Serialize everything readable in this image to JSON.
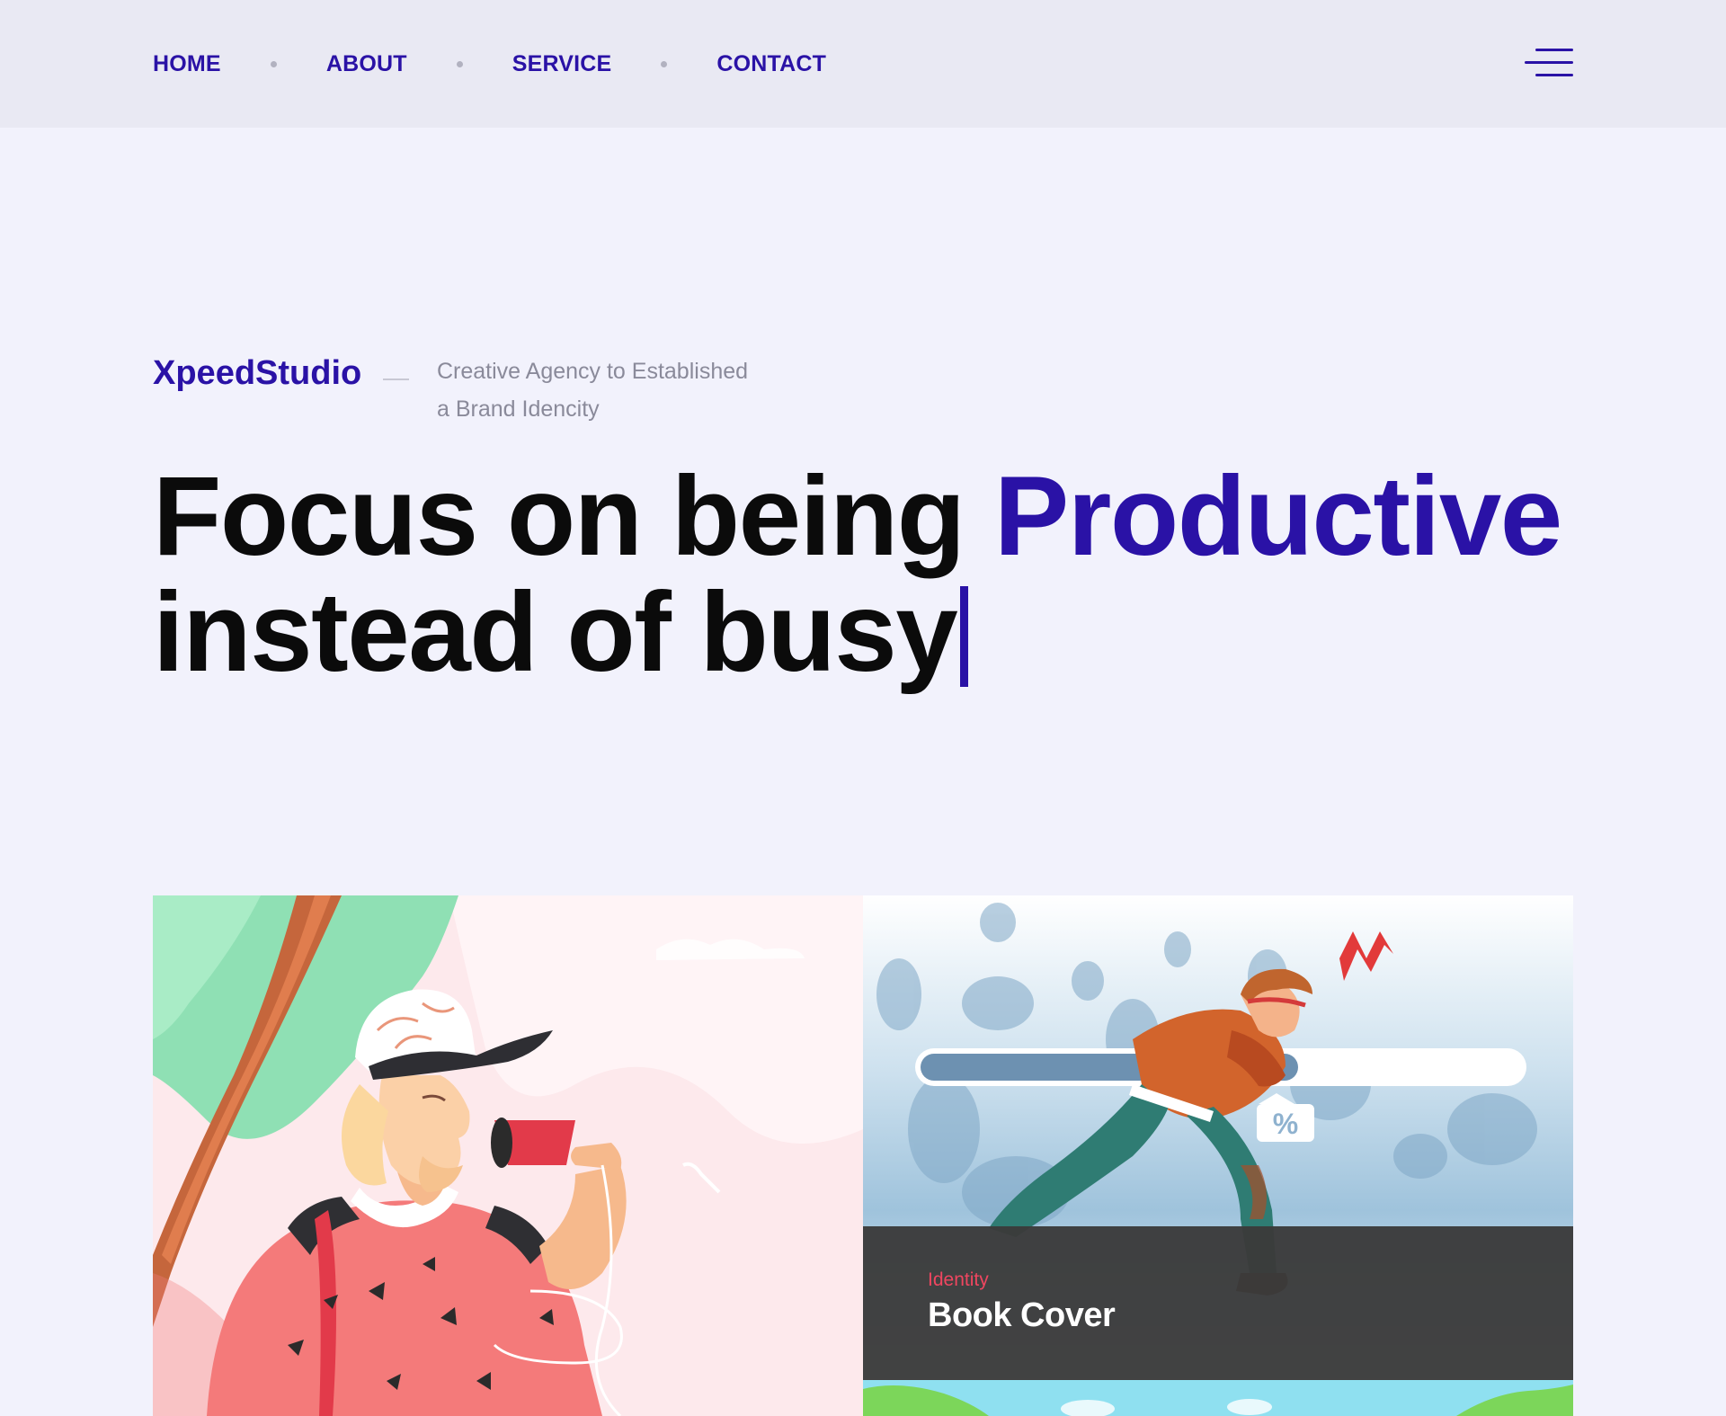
{
  "header": {
    "nav": [
      {
        "label": "HOME"
      },
      {
        "label": "ABOUT"
      },
      {
        "label": "SERVICE"
      },
      {
        "label": "CONTACT"
      }
    ],
    "menu_icon": "hamburger-menu-icon"
  },
  "hero": {
    "brand": "XpeedStudio",
    "tagline_line1": "Creative Agency to Established",
    "tagline_line2": "a Brand Idencity",
    "headline_part1": "Focus on being ",
    "headline_accent": "Productive",
    "headline_part2": "instead of busy"
  },
  "portfolio": {
    "items": [
      {
        "image": "illustration-man-with-can-phone"
      },
      {
        "image": "illustration-running-man-progress-bar",
        "category": "Identity",
        "title": "Book Cover"
      },
      {
        "image": "illustration-green-landscape"
      }
    ]
  },
  "colors": {
    "accent": "#2a12a6",
    "background": "#f2f2fc",
    "header_bg": "#e9e9f3",
    "category": "#ef4660"
  }
}
